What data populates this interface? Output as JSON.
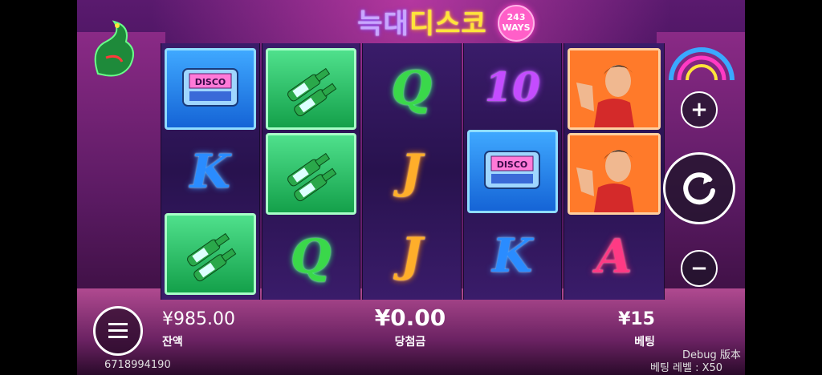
{
  "game": {
    "title_part1": "늑대",
    "title_part2": "디스코",
    "ways_number": "243",
    "ways_label": "WAYS"
  },
  "reels": [
    [
      "disco-pager",
      "K",
      "soju-bottles"
    ],
    [
      "soju-bottles",
      "soju-bottles",
      "Q"
    ],
    [
      "Q",
      "J",
      "J"
    ],
    [
      "10",
      "disco-pager",
      "K"
    ],
    [
      "wolf-man",
      "wolf-man",
      "A"
    ]
  ],
  "symbol_text": {
    "q": "Q",
    "j": "J",
    "k": "K",
    "a": "A",
    "ten": "10",
    "disco": "DISCO"
  },
  "hud": {
    "balance_value": "¥985.00",
    "balance_label": "잔액",
    "win_value": "¥0.00",
    "win_label": "당첨금",
    "bet_value": "¥15",
    "bet_label": "베팅"
  },
  "controls": {
    "plus": "+",
    "minus": "−"
  },
  "footer": {
    "session_id": "6718994190",
    "debug": "Debug 版本",
    "bet_level": "베팅 레벨 : X50"
  }
}
